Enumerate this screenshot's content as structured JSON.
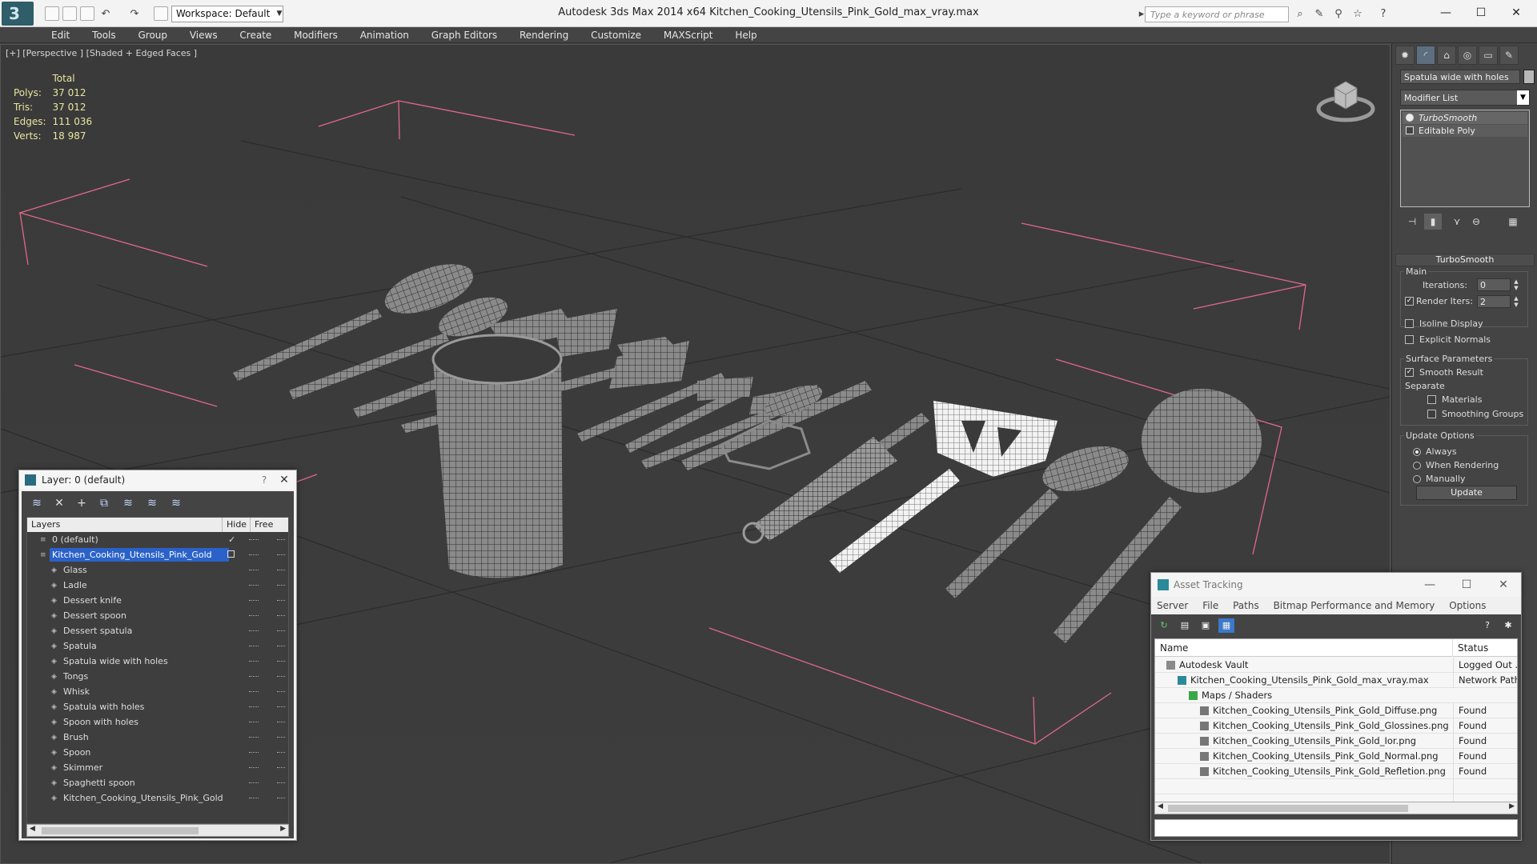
{
  "titlebar": {
    "app_title": "Autodesk 3ds Max  2014 x64      Kitchen_Cooking_Utensils_Pink_Gold_max_vray.max",
    "workspace": "Workspace: Default",
    "search_placeholder": "Type a keyword or phrase"
  },
  "menu": [
    "Edit",
    "Tools",
    "Group",
    "Views",
    "Create",
    "Modifiers",
    "Animation",
    "Graph Editors",
    "Rendering",
    "Customize",
    "MAXScript",
    "Help"
  ],
  "viewport": {
    "label": "[+] [Perspective ] [Shaded + Edged Faces ]",
    "stats": {
      "header": "Total",
      "rows": [
        {
          "label": "Polys:",
          "value": "37 012"
        },
        {
          "label": "Tris:",
          "value": "37 012"
        },
        {
          "label": "Edges:",
          "value": "111 036"
        },
        {
          "label": "Verts:",
          "value": "18 987"
        }
      ]
    }
  },
  "command_panel": {
    "object_name": "Spatula wide with holes",
    "modifier_list": "Modifier List",
    "stack": [
      "TurboSmooth",
      "Editable Poly"
    ],
    "rollout_title": "TurboSmooth",
    "main": {
      "title": "Main",
      "iterations_label": "Iterations:",
      "iterations": "0",
      "render_iters_label": "Render Iters:",
      "render_iters": "2",
      "isoline": "Isoline Display",
      "explicit_normals": "Explicit Normals"
    },
    "surface": {
      "title": "Surface Parameters",
      "smooth_result": "Smooth Result",
      "separate": "Separate",
      "materials": "Materials",
      "smoothing_groups": "Smoothing Groups"
    },
    "update_options": {
      "title": "Update Options",
      "always": "Always",
      "when_rendering": "When Rendering",
      "manually": "Manually",
      "update_button": "Update"
    }
  },
  "layer_window": {
    "title": "Layer: 0 (default)",
    "help": "?",
    "columns": [
      "Layers",
      "Hide",
      "Free"
    ],
    "rows": [
      {
        "name": "0 (default)",
        "level": 1,
        "type": "layer"
      },
      {
        "name": "Kitchen_Cooking_Utensils_Pink_Gold",
        "level": 1,
        "type": "layer",
        "selected": true
      },
      {
        "name": "Glass",
        "level": 2,
        "type": "object"
      },
      {
        "name": "Ladle",
        "level": 2,
        "type": "object"
      },
      {
        "name": "Dessert knife",
        "level": 2,
        "type": "object"
      },
      {
        "name": "Dessert spoon",
        "level": 2,
        "type": "object"
      },
      {
        "name": "Dessert spatula",
        "level": 2,
        "type": "object"
      },
      {
        "name": "Spatula",
        "level": 2,
        "type": "object"
      },
      {
        "name": "Spatula wide with holes",
        "level": 2,
        "type": "object"
      },
      {
        "name": "Tongs",
        "level": 2,
        "type": "object"
      },
      {
        "name": "Whisk",
        "level": 2,
        "type": "object"
      },
      {
        "name": "Spatula with holes",
        "level": 2,
        "type": "object"
      },
      {
        "name": "Spoon with holes",
        "level": 2,
        "type": "object"
      },
      {
        "name": "Brush",
        "level": 2,
        "type": "object"
      },
      {
        "name": "Spoon",
        "level": 2,
        "type": "object"
      },
      {
        "name": "Skimmer",
        "level": 2,
        "type": "object"
      },
      {
        "name": "Spaghetti spoon",
        "level": 2,
        "type": "object"
      },
      {
        "name": "Kitchen_Cooking_Utensils_Pink_Gold",
        "level": 2,
        "type": "object"
      }
    ]
  },
  "asset_window": {
    "title": "Asset Tracking",
    "menu": [
      "Server",
      "File",
      "Paths",
      "Bitmap Performance and Memory",
      "Options"
    ],
    "columns": [
      "Name",
      "Status"
    ],
    "rows": [
      {
        "name": "Autodesk Vault",
        "status": "Logged Out ...",
        "level": 1,
        "icon": "vault-icon"
      },
      {
        "name": "Kitchen_Cooking_Utensils_Pink_Gold_max_vray.max",
        "status": "Network Path",
        "level": 2,
        "icon": "max-file-icon"
      },
      {
        "name": "Maps / Shaders",
        "status": "",
        "level": 3,
        "icon": "maps-icon"
      },
      {
        "name": "Kitchen_Cooking_Utensils_Pink_Gold_Diffuse.png",
        "status": "Found",
        "level": 4,
        "icon": "image-file-icon"
      },
      {
        "name": "Kitchen_Cooking_Utensils_Pink_Gold_Glossines.png",
        "status": "Found",
        "level": 4,
        "icon": "image-file-icon"
      },
      {
        "name": "Kitchen_Cooking_Utensils_Pink_Gold_Ior.png",
        "status": "Found",
        "level": 4,
        "icon": "image-file-icon"
      },
      {
        "name": "Kitchen_Cooking_Utensils_Pink_Gold_Normal.png",
        "status": "Found",
        "level": 4,
        "icon": "image-file-icon"
      },
      {
        "name": "Kitchen_Cooking_Utensils_Pink_Gold_Refletion.png",
        "status": "Found",
        "level": 4,
        "icon": "image-file-icon"
      }
    ]
  },
  "colors": {
    "bounding_box": "#e0678a",
    "selection": "#2a62c9",
    "viewport_bg": "#3a3a3a",
    "stats_text": "#e8e6a0"
  }
}
